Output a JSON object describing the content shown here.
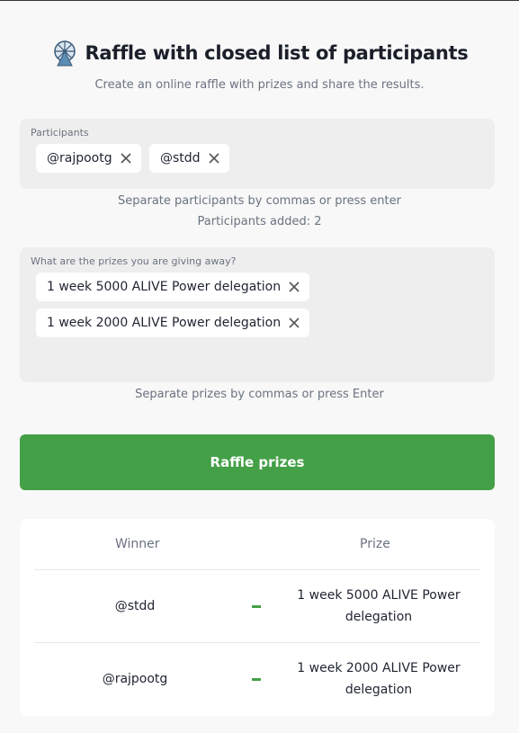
{
  "header": {
    "title": "Raffle with closed list of participants",
    "subtitle": "Create an online raffle with prizes and share the results.",
    "icon": "ferris-wheel-icon"
  },
  "participants": {
    "label": "Participants",
    "items": [
      "@rajpootg",
      "@stdd"
    ],
    "hint": "Separate participants by commas or press enter",
    "count_text": "Participants added: 2",
    "remove_icon": "close-icon"
  },
  "prizes": {
    "label": "What are the prizes you are giving away?",
    "items": [
      "1 week 5000 ALIVE Power delegation",
      "1 week 2000 ALIVE Power delegation"
    ],
    "hint": "Separate prizes by commas or press Enter",
    "remove_icon": "close-icon"
  },
  "action": {
    "raffle_label": "Raffle prizes",
    "color": "#44a047"
  },
  "results": {
    "headers": {
      "winner": "Winner",
      "prize": "Prize"
    },
    "rows": [
      {
        "winner": "@stdd",
        "prize": "1 week 5000 ALIVE Power delegation"
      },
      {
        "winner": "@rajpootg",
        "prize": "1 week 2000 ALIVE Power delegation"
      }
    ]
  }
}
